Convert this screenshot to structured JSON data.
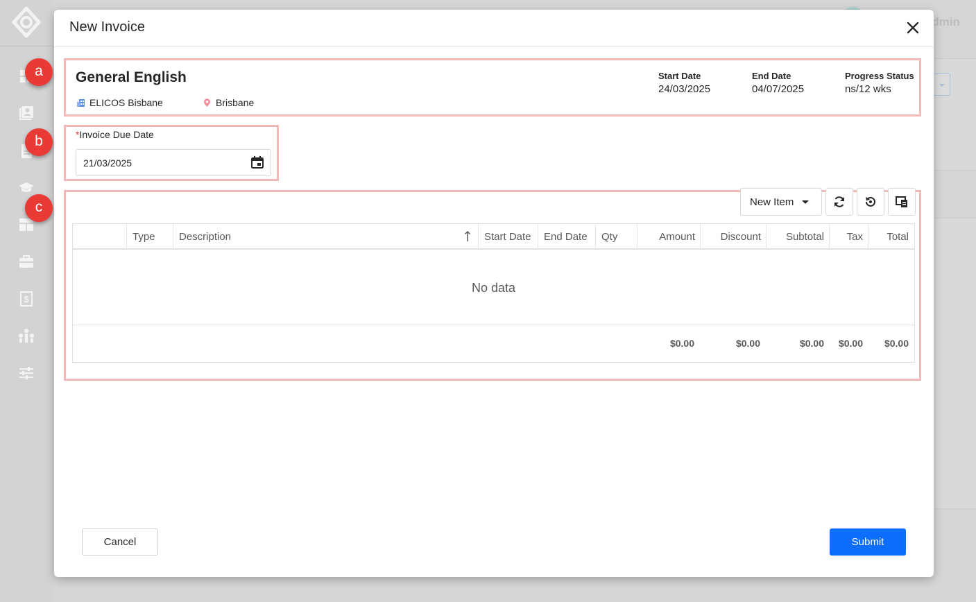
{
  "header": {
    "user_name": "Admin"
  },
  "modal": {
    "title": "New Invoice",
    "course": {
      "name": "General English",
      "provider": "ELICOS Bisbane",
      "location": "Brisbane",
      "start_label": "Start Date",
      "start_value": "24/03/2025",
      "end_label": "End Date",
      "end_value": "04/07/2025",
      "progress_label": "Progress Status",
      "progress_value": "ns/12 wks"
    },
    "due_date": {
      "required_marker": "*",
      "label": "Invoice Due Date",
      "value": "21/03/2025"
    },
    "toolbar": {
      "new_item_label": "New Item"
    },
    "table": {
      "columns": [
        "",
        "Type",
        "Description",
        "Start Date",
        "End Date",
        "Qty",
        "Amount",
        "Discount",
        "Subtotal",
        "Tax",
        "Total"
      ],
      "empty_text": "No data",
      "totals": {
        "amount": "$0.00",
        "discount": "$0.00",
        "subtotal": "$0.00",
        "tax": "$0.00",
        "total": "$0.00"
      }
    },
    "buttons": {
      "cancel": "Cancel",
      "submit": "Submit"
    }
  },
  "callouts": [
    "a",
    "b",
    "c"
  ],
  "icons": [
    "logo-icon",
    "dashboard-icon",
    "contacts-icon",
    "document-icon",
    "graduation-cap-icon",
    "layout-icon",
    "briefcase-icon",
    "invoice-icon",
    "network-icon",
    "settings-sliders-icon",
    "close-icon",
    "building-icon",
    "location-pin-icon",
    "calendar-icon",
    "refresh-icon",
    "reset-icon",
    "columns-icon",
    "sort-ascending-icon"
  ],
  "colors": {
    "primary": "#0d6efd",
    "highlight_border": "#f2b9b9",
    "callout": "#ea3a35",
    "required": "#e03131"
  }
}
